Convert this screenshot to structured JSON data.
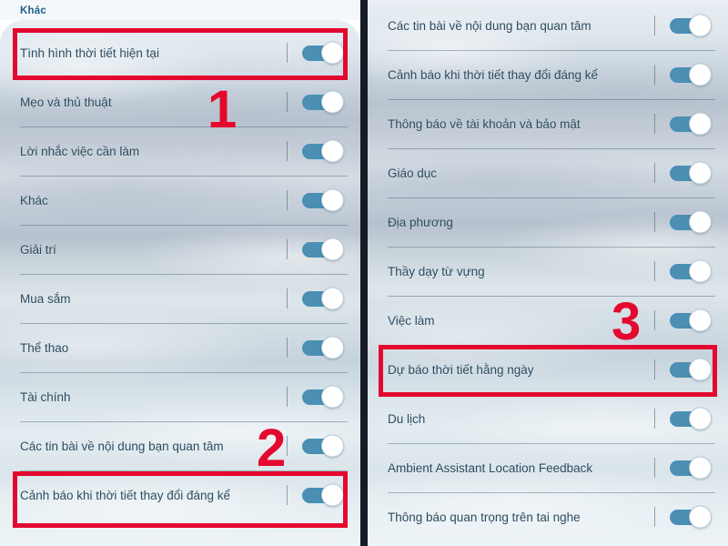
{
  "meta": {
    "left_panel_title": "Khác"
  },
  "colors": {
    "annotation_red": "#e4082f",
    "toggle_on": "#4b8fb5",
    "label_text": "#2d4b60",
    "section_header": "#1f5f8b",
    "panel_gutter": "#151c26"
  },
  "left_panel": {
    "header": "Khác",
    "rows": [
      {
        "label": "Tình hình thời tiết hiện tại",
        "toggle": "on"
      },
      {
        "label": "Mẹo và thủ thuật",
        "toggle": "on"
      },
      {
        "label": "Lời nhắc việc cần làm",
        "toggle": "on"
      },
      {
        "label": "Khác",
        "toggle": "on"
      },
      {
        "label": "Giải trí",
        "toggle": "on"
      },
      {
        "label": "Mua sắm",
        "toggle": "on"
      },
      {
        "label": "Thể thao",
        "toggle": "on"
      },
      {
        "label": "Tài chính",
        "toggle": "on"
      },
      {
        "label": "Các tin bài về nội dung bạn quan tâm",
        "toggle": "on"
      },
      {
        "label": "Cảnh báo khi thời tiết thay đổi đáng kể",
        "toggle": "on"
      }
    ]
  },
  "right_panel": {
    "rows": [
      {
        "label": "Các tin bài về nội dung bạn quan tâm",
        "toggle": "on"
      },
      {
        "label": "Cảnh báo khi thời tiết thay đổi đáng kể",
        "toggle": "on"
      },
      {
        "label": "Thông báo về tài khoản và bảo mật",
        "toggle": "on"
      },
      {
        "label": "Giáo dục",
        "toggle": "on"
      },
      {
        "label": "Địa phương",
        "toggle": "on"
      },
      {
        "label": "Thầy dạy từ vựng",
        "toggle": "on"
      },
      {
        "label": "Việc làm",
        "toggle": "on"
      },
      {
        "label": "Dự báo thời tiết hằng ngày",
        "toggle": "on"
      },
      {
        "label": "Du lịch",
        "toggle": "on"
      },
      {
        "label": "Ambient Assistant Location Feedback",
        "toggle": "on"
      },
      {
        "label": "Thông báo quan trọng trên tai nghe",
        "toggle": "on"
      }
    ]
  },
  "annotations": {
    "markers": [
      {
        "id": "1",
        "label": "1",
        "panel": "left"
      },
      {
        "id": "2",
        "label": "2",
        "panel": "left"
      },
      {
        "id": "3",
        "label": "3",
        "panel": "right"
      }
    ],
    "highlight_boxes": [
      {
        "id": "box-1",
        "target": "Tình hình thời tiết hiện tại",
        "panel": "left"
      },
      {
        "id": "box-2",
        "target": "Cảnh báo khi thời tiết thay đổi đáng kể",
        "panel": "left"
      },
      {
        "id": "box-3",
        "target": "Dự báo thời tiết hằng ngày",
        "panel": "right"
      }
    ]
  }
}
